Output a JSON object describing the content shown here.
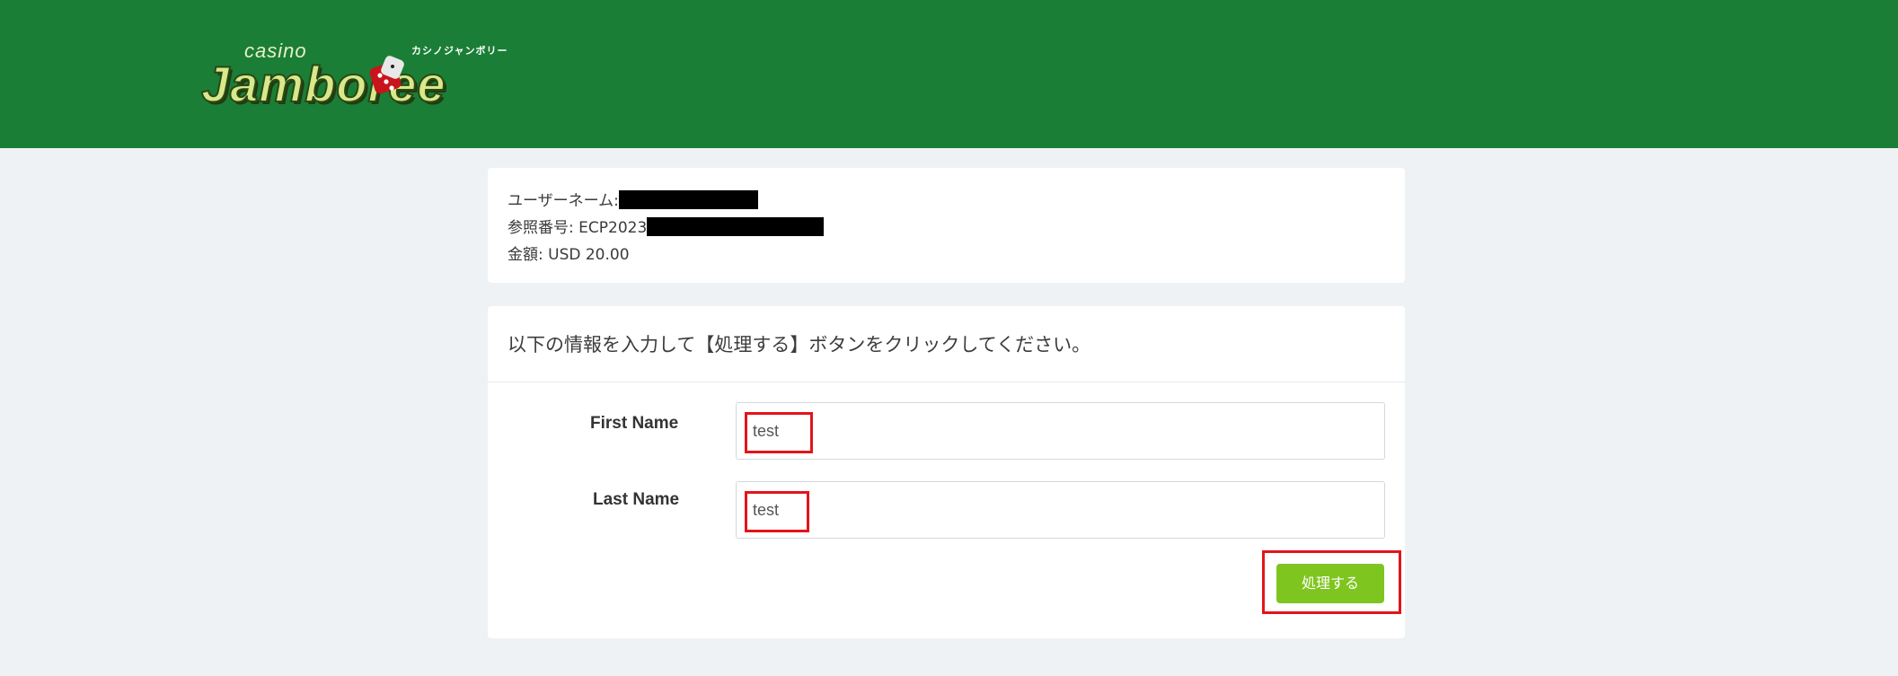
{
  "header": {
    "logo": {
      "casino_text": "casino",
      "brand_text": "Jamboree",
      "kana_text": "カシノジャンボリー"
    },
    "background_color": "#1a7e36"
  },
  "info": {
    "username_label": "ユーザーネーム:",
    "reference_label": "参照番号:",
    "reference_prefix": "ECP2023",
    "amount_label": "金額:",
    "amount_value": "USD 20.00"
  },
  "form": {
    "instruction": "以下の情報を入力して【処理する】ボタンをクリックしてください。",
    "first_name_label": "First Name",
    "first_name_value": "test",
    "last_name_label": "Last Name",
    "last_name_value": "test",
    "submit_label": "処理する"
  },
  "colors": {
    "accent_button": "#7ec51f",
    "highlight": "#e3141a",
    "page_background": "#eff2f5"
  }
}
